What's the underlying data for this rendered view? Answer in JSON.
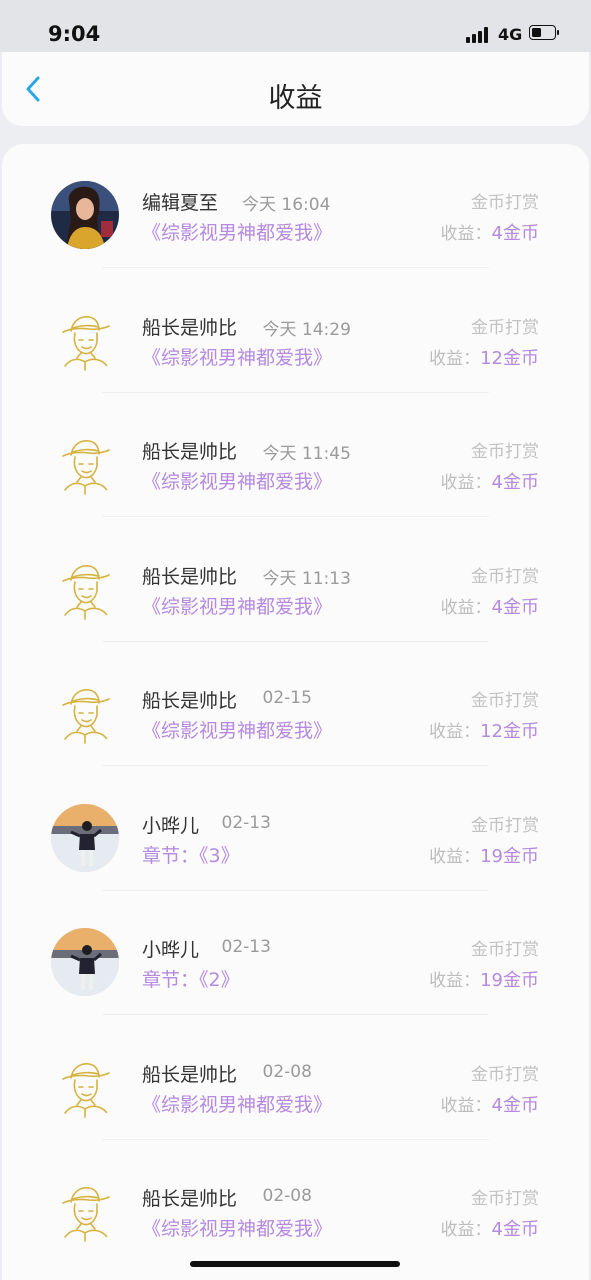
{
  "status": {
    "time": "9:04",
    "network": "4G"
  },
  "header": {
    "title": "收益",
    "back_icon": "chevron-left-icon"
  },
  "colors": {
    "accent": "#b58ae0",
    "back": "#2aa7e8",
    "gold": "#d6b23f"
  },
  "records": [
    {
      "name": "编辑夏至",
      "time": "今天 16:04",
      "work": "《综影视男神都爱我》",
      "type": "金币打赏",
      "earn_label": "收益：",
      "earn_value": "4金币",
      "avatar": "photo-woman"
    },
    {
      "name": "船长是帅比",
      "time": "今天 14:29",
      "work": "《综影视男神都爱我》",
      "type": "金币打赏",
      "earn_label": "收益：",
      "earn_value": "12金币",
      "avatar": "straw-hat-sketch"
    },
    {
      "name": "船长是帅比",
      "time": "今天 11:45",
      "work": "《综影视男神都爱我》",
      "type": "金币打赏",
      "earn_label": "收益：",
      "earn_value": "4金币",
      "avatar": "straw-hat-sketch"
    },
    {
      "name": "船长是帅比",
      "time": "今天 11:13",
      "work": "《综影视男神都爱我》",
      "type": "金币打赏",
      "earn_label": "收益：",
      "earn_value": "4金币",
      "avatar": "straw-hat-sketch"
    },
    {
      "name": "船长是帅比",
      "time": "02-15",
      "work": "《综影视男神都爱我》",
      "type": "金币打赏",
      "earn_label": "收益：",
      "earn_value": "12金币",
      "avatar": "straw-hat-sketch"
    },
    {
      "name": "小晔儿",
      "time": "02-13",
      "work": "章节：《3》",
      "type": "金币打赏",
      "earn_label": "收益：",
      "earn_value": "19金币",
      "avatar": "photo-sunset"
    },
    {
      "name": "小晔儿",
      "time": "02-13",
      "work": "章节：《2》",
      "type": "金币打赏",
      "earn_label": "收益：",
      "earn_value": "19金币",
      "avatar": "photo-sunset"
    },
    {
      "name": "船长是帅比",
      "time": "02-08",
      "work": "《综影视男神都爱我》",
      "type": "金币打赏",
      "earn_label": "收益：",
      "earn_value": "4金币",
      "avatar": "straw-hat-sketch"
    },
    {
      "name": "船长是帅比",
      "time": "02-08",
      "work": "《综影视男神都爱我》",
      "type": "金币打赏",
      "earn_label": "收益：",
      "earn_value": "4金币",
      "avatar": "straw-hat-sketch"
    }
  ]
}
